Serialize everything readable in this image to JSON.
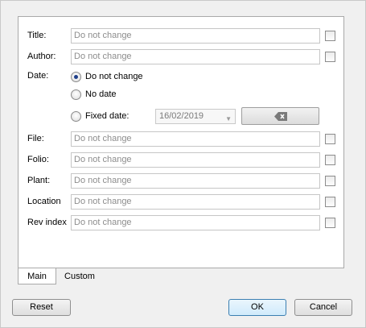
{
  "fields": [
    {
      "key": "title",
      "label": "Title:",
      "value": "Do not change"
    },
    {
      "key": "author",
      "label": "Author:",
      "value": "Do not change"
    },
    {
      "key": "file",
      "label": "File:",
      "value": "Do not change"
    },
    {
      "key": "folio",
      "label": "Folio:",
      "value": "Do not change"
    },
    {
      "key": "plant",
      "label": "Plant:",
      "value": "Do not change"
    },
    {
      "key": "location",
      "label": "Location",
      "value": "Do not change"
    },
    {
      "key": "rev",
      "label": "Rev index",
      "value": "Do not change"
    }
  ],
  "date": {
    "label": "Date:",
    "options": [
      "Do not change",
      "No date",
      "Fixed date:"
    ],
    "selected": 0,
    "fixed_value": "16/02/2019"
  },
  "tabs": [
    "Main",
    "Custom"
  ],
  "buttons": {
    "reset": "Reset",
    "ok": "OK",
    "cancel": "Cancel"
  },
  "colors": {
    "accent": "#3c7fb1",
    "placeholder": "#8d8d8d"
  },
  "icons": {
    "clear": "backspace-clear-icon",
    "dropdown": "chevron-down-icon"
  }
}
